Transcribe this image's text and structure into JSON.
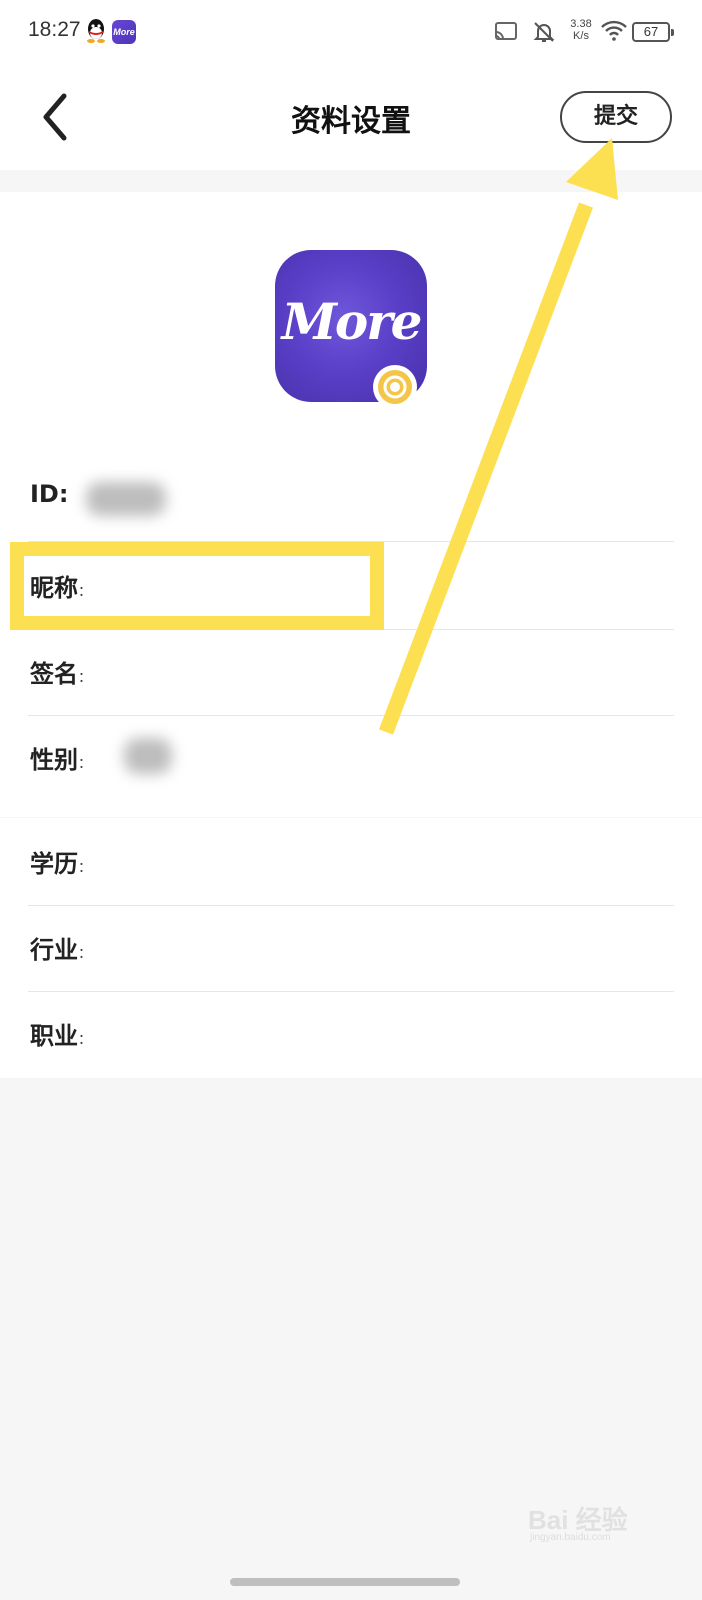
{
  "status_bar": {
    "time": "18:27",
    "app_badge": "More",
    "net_speed_value": "3.38",
    "net_speed_unit": "K/s",
    "battery": "67",
    "icons": [
      "qq-icon",
      "more-app-icon",
      "cast-icon",
      "bell-off-icon",
      "wifi-icon",
      "battery-icon"
    ]
  },
  "header": {
    "title": "资料设置",
    "submit_label": "提交",
    "back_icon": "chevron-left-icon"
  },
  "avatar": {
    "text": "More",
    "colors": {
      "start": "#6f58da",
      "end": "#4631a8"
    },
    "badge_icon": "camera-icon"
  },
  "profile_fields": [
    {
      "label": "ID:",
      "colon": "",
      "value_blurred": true
    },
    {
      "label": "昵称",
      "colon": "：",
      "value_blurred": false
    },
    {
      "label": "签名",
      "colon": "：",
      "value_blurred": false
    },
    {
      "label": "性别",
      "colon": "：",
      "value_blurred": true
    }
  ],
  "detail_fields": [
    {
      "label": "学历",
      "colon": "："
    },
    {
      "label": "行业",
      "colon": "："
    },
    {
      "label": "职业",
      "colon": "："
    }
  ],
  "annotation": {
    "highlight_color": "#fde052",
    "arrow_color": "#fde052"
  },
  "watermark": {
    "brand": "Bai 经验",
    "sub": "jingyan.baidu.com"
  }
}
